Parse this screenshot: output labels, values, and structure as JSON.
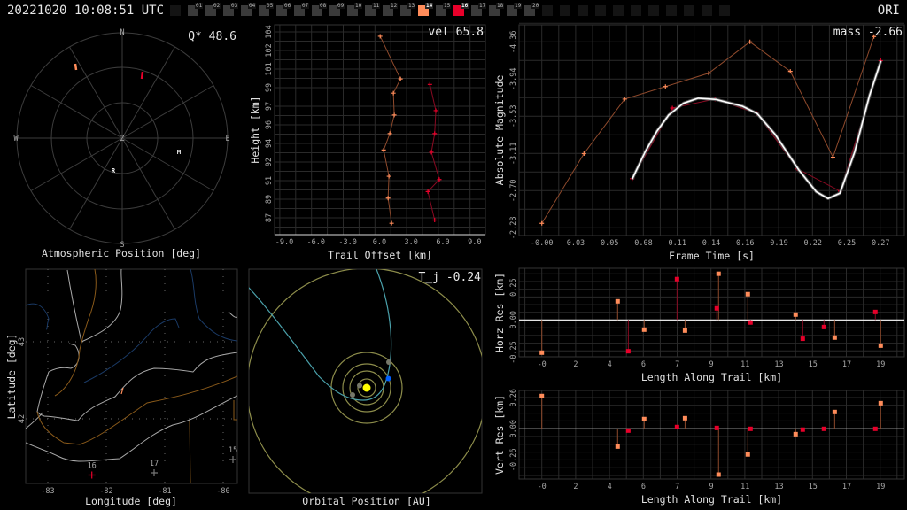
{
  "header": {
    "timestamp": "20221020 10:08:51 UTC",
    "mode": "ORI",
    "stations": [
      {
        "label": "",
        "state": "empty"
      },
      {
        "label": "01",
        "state": "idle"
      },
      {
        "label": "02",
        "state": "idle"
      },
      {
        "label": "03",
        "state": "idle"
      },
      {
        "label": "04",
        "state": "idle"
      },
      {
        "label": "05",
        "state": "idle"
      },
      {
        "label": "06",
        "state": "idle"
      },
      {
        "label": "07",
        "state": "idle"
      },
      {
        "label": "08",
        "state": "idle"
      },
      {
        "label": "09",
        "state": "idle"
      },
      {
        "label": "10",
        "state": "idle"
      },
      {
        "label": "11",
        "state": "idle"
      },
      {
        "label": "12",
        "state": "idle"
      },
      {
        "label": "13",
        "state": "idle"
      },
      {
        "label": "14",
        "state": "orange"
      },
      {
        "label": "15",
        "state": "idle"
      },
      {
        "label": "16",
        "state": "red"
      },
      {
        "label": "17",
        "state": "idle"
      },
      {
        "label": "18",
        "state": "idle"
      },
      {
        "label": "19",
        "state": "idle"
      },
      {
        "label": "20",
        "state": "idle"
      },
      {
        "label": "",
        "state": "empty"
      },
      {
        "label": "",
        "state": "empty"
      },
      {
        "label": "",
        "state": "empty"
      },
      {
        "label": "",
        "state": "empty"
      },
      {
        "label": "",
        "state": "empty"
      },
      {
        "label": "",
        "state": "empty"
      },
      {
        "label": "",
        "state": "empty"
      },
      {
        "label": "",
        "state": "empty"
      },
      {
        "label": "",
        "state": "empty"
      },
      {
        "label": "",
        "state": "empty"
      },
      {
        "label": "",
        "state": "empty"
      }
    ]
  },
  "colors": {
    "cam_a": "#ff8c5a",
    "cam_b": "#e8002a",
    "cam_a_line": "#8f4a2c",
    "cam_b_line": "#8a0a22",
    "fit": "#ffffff",
    "grid": "#2a2a2a"
  },
  "polar": {
    "title": "Atmospheric Position [deg]",
    "annotation": "Q* 48.6",
    "labels": {
      "n": "N",
      "s": "S",
      "e": "E",
      "w": "W",
      "z": "Z"
    },
    "markers": {
      "moon": "M",
      "radiant": "R"
    }
  },
  "map": {
    "xlabel": "Longitude [deg]",
    "ylabel": "Latitude [deg]",
    "lon_ticks": [
      "-83",
      "-82",
      "-81",
      "-80"
    ],
    "lat_ticks": [
      "43",
      "42"
    ],
    "stations": [
      {
        "label": "16",
        "color": "#e8002a"
      },
      {
        "label": "17",
        "color": "#777777"
      },
      {
        "label": "15",
        "color": "#777777"
      }
    ]
  },
  "orbit": {
    "title": "Orbital Position [AU]",
    "annotation": "T_j -0.24"
  },
  "chart_data": [
    {
      "id": "trail",
      "type": "line",
      "xlabel": "Trail Offset [km]",
      "ylabel": "Height [km]",
      "annotation": "vel 65.8",
      "xlim": [
        -9.9,
        10.0
      ],
      "ylim": [
        86.0,
        104.5
      ],
      "x_ticks": [
        "-9.0",
        "-6.0",
        "-3.0",
        "0.0",
        "3.0",
        "6.0",
        "9.0"
      ],
      "y_ticks": [
        "104",
        "102",
        "101",
        "99",
        "97",
        "96",
        "94",
        "92",
        "91",
        "89",
        "87"
      ],
      "series": [
        {
          "name": "cam_a",
          "x": [
            0.06,
            1.98,
            1.31,
            1.39,
            0.97,
            0.39,
            0.89,
            0.81,
            1.14
          ],
          "y": [
            103.6,
            99.7,
            98.4,
            96.4,
            94.7,
            93.2,
            90.8,
            88.8,
            86.5
          ]
        },
        {
          "name": "cam_b",
          "x": [
            4.76,
            5.32,
            5.21,
            4.9,
            5.65,
            4.57,
            5.21
          ],
          "y": [
            99.2,
            96.8,
            94.7,
            93.0,
            90.5,
            89.4,
            86.8
          ]
        }
      ]
    },
    {
      "id": "magnitude",
      "type": "line",
      "xlabel": "Frame Time [s]",
      "ylabel": "Absolute Magnitude",
      "annotation": "mass -2.66",
      "x_ticks": [
        "-0.00",
        "0.03",
        "0.05",
        "0.08",
        "0.11",
        "0.14",
        "0.16",
        "0.19",
        "0.22",
        "0.25",
        "0.27"
      ],
      "y_ticks": [
        "-4.36",
        "-3.94",
        "-3.53",
        "-3.11",
        "-2.70",
        "-2.28"
      ],
      "series": [
        {
          "name": "cam_a",
          "x": [
            0.0,
            0.0336,
            0.066,
            0.0985,
            0.133,
            0.1658,
            0.198,
            0.232,
            0.2646
          ],
          "y": [
            -2.33,
            -3.11,
            -3.72,
            -3.86,
            -4.01,
            -4.36,
            -4.03,
            -3.07,
            -4.42
          ]
        },
        {
          "name": "cam_b",
          "x": [
            0.072,
            0.104,
            0.138,
            0.1714,
            0.2036,
            0.2377,
            0.27
          ],
          "y": [
            -2.83,
            -3.62,
            -3.72,
            -3.56,
            -2.94,
            -2.69,
            -4.15
          ]
        },
        {
          "name": "fit",
          "x": [
            0.072,
            0.0823,
            0.0917,
            0.1011,
            0.1129,
            0.1246,
            0.1387,
            0.1599,
            0.1716,
            0.1858,
            0.2046,
            0.2187,
            0.2281,
            0.2375,
            0.2493,
            0.261,
            0.2702
          ],
          "y": [
            -2.825,
            -3.129,
            -3.36,
            -3.542,
            -3.674,
            -3.73,
            -3.716,
            -3.64,
            -3.558,
            -3.327,
            -2.931,
            -2.683,
            -2.607,
            -2.667,
            -3.13,
            -3.756,
            -4.149
          ]
        }
      ]
    },
    {
      "id": "horz_res",
      "type": "scatter",
      "xlabel": "Length Along Trail [km]",
      "ylabel": "Horz Res [km]",
      "x_ticks": [
        "-0",
        "2",
        "4",
        "6",
        "7",
        "9",
        "11",
        "13",
        "15",
        "17",
        "19"
      ],
      "y_ticks": [
        "0.25",
        "0.00",
        "-0.25"
      ],
      "series": [
        {
          "name": "cam_a",
          "x": [
            0,
            4.25,
            5.74,
            8.03,
            9.91,
            11.55,
            14.23,
            16.42,
            19.0
          ],
          "y": [
            -0.252,
            0.143,
            -0.075,
            -0.082,
            0.355,
            0.198,
            0.041,
            -0.136,
            -0.198
          ]
        },
        {
          "name": "cam_b",
          "x": [
            4.85,
            7.58,
            9.81,
            11.7,
            14.63,
            15.82,
            18.7
          ],
          "y": [
            -0.241,
            0.314,
            0.089,
            -0.02,
            -0.145,
            -0.055,
            0.061
          ]
        }
      ]
    },
    {
      "id": "vert_res",
      "type": "scatter",
      "xlabel": "Length Along Trail [km]",
      "ylabel": "Vert Res [km]",
      "x_ticks": [
        "-0",
        "2",
        "4",
        "6",
        "7",
        "9",
        "11",
        "13",
        "15",
        "17",
        "19"
      ],
      "y_ticks": [
        "0.26",
        "0.00",
        "-0.26"
      ],
      "series": [
        {
          "name": "cam_a",
          "x": [
            0,
            4.25,
            5.74,
            8.03,
            9.91,
            11.55,
            14.23,
            16.42,
            19.0
          ],
          "y": [
            0.275,
            -0.149,
            0.082,
            0.089,
            -0.384,
            -0.215,
            -0.045,
            0.141,
            0.215
          ]
        },
        {
          "name": "cam_b",
          "x": [
            4.85,
            7.58,
            9.81,
            11.7,
            14.63,
            15.82,
            18.7
          ],
          "y": [
            -0.015,
            0.015,
            0.007,
            0.0,
            -0.007,
            0.0,
            0.0
          ]
        }
      ]
    }
  ]
}
